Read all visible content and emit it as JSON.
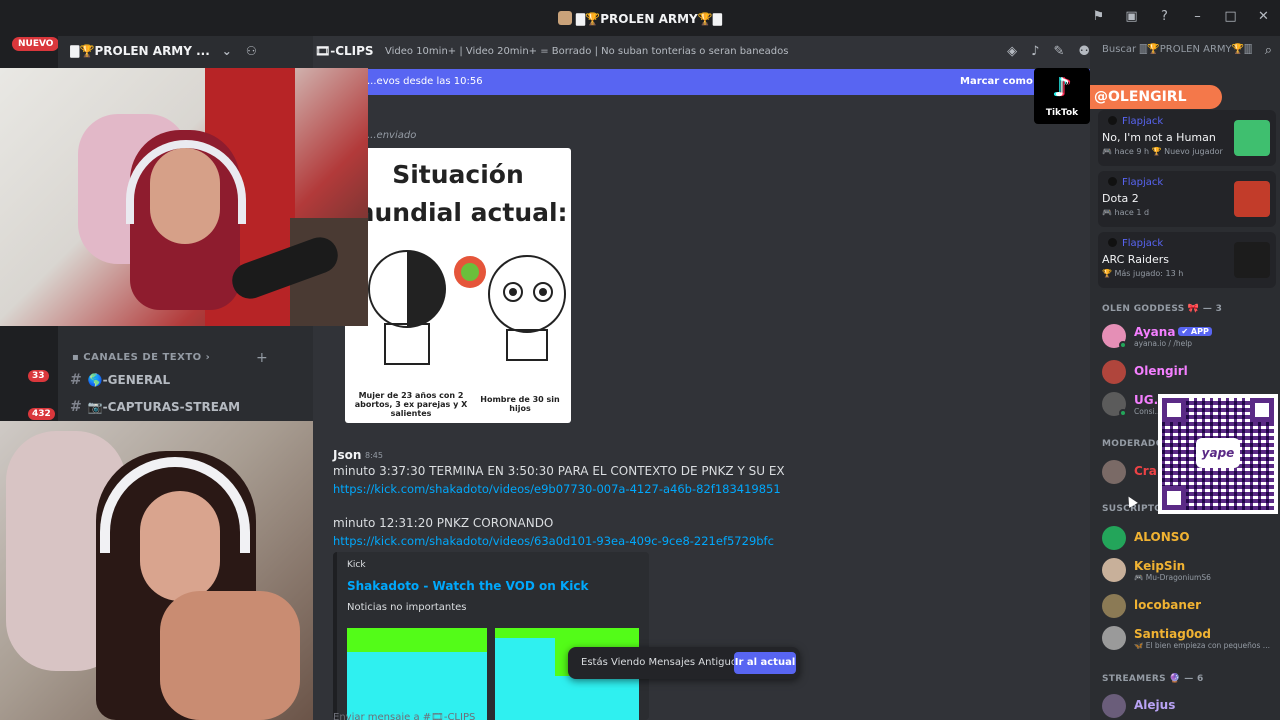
{
  "titlebar": {
    "title": "🀫🏆PROLEN ARMY🏆🀫"
  },
  "rail": {
    "new_badge": "NUEVO",
    "counts": [
      "33",
      "432"
    ]
  },
  "server": {
    "name": "🀫🏆PROLEN ARMY ..."
  },
  "sidebar": {
    "category": "CANALES DE TEXTO",
    "channels": [
      {
        "label": "🌎-GENERAL"
      },
      {
        "label": "📷-CAPTURAS-STREAM"
      }
    ]
  },
  "chat": {
    "channel_name": "🎞-CLIPS",
    "topic": "Video 10min+ | Video 20min+ = Borrado | No suban tonterias o seran baneados",
    "new_messages_bar": "...evos desde las 10:56",
    "mark_read": "Marcar como leí...",
    "sent_label": "...enviado",
    "meme": {
      "title1": "Situación",
      "title2": "mundial actual:",
      "caption_left": "Mujer de 23 años con 2 abortos, 3 ex parejas y X salientes",
      "caption_right": "Hombre de 30 sin hijos"
    },
    "message": {
      "author": "Json",
      "time": "8:45",
      "line1": "minuto 3:37:30  TERMINA EN  3:50:30  PARA EL CONTEXTO DE PNKZ Y SU EX",
      "link1": "https://kick.com/shakadoto/videos/e9b07730-007a-4127-a46b-82f183419851",
      "line2": "minuto 12:31:20 PNKZ CORONANDO",
      "link2": "https://kick.com/shakadoto/videos/63a0d101-93ea-409c-9ce8-221ef5729bfc"
    },
    "embed": {
      "provider": "Kick",
      "title": "Shakadoto - Watch the VOD on Kick",
      "description": "Noticias no importantes"
    },
    "old_messages_notice": "Estás Viendo Mensajes Antiguos",
    "jump_button": "Ir al actual",
    "composer_placeholder": "Enviar mensaje a #🎞-CLIPS"
  },
  "members": {
    "search_placeholder": "Buscar 🀫🏆PROLEN ARMY🏆🀫",
    "overlay_handle": "@OLENGIRL",
    "tiktok_label": "TikTok",
    "activities": [
      {
        "user": "Flapjack",
        "game": "No, I'm not a Human",
        "meta": "🎮 hace 9 h  🏆 Nuevo jugador",
        "art_color": "#3fbf6f"
      },
      {
        "user": "Flapjack",
        "game": "Dota 2",
        "meta": "🎮 hace 1 d",
        "art_color": "#c23c2a"
      },
      {
        "user": "Flapjack",
        "game": "ARC Raiders",
        "meta": "🏆 Más jugado: 13 h",
        "art_color": "#1c1c1c"
      }
    ],
    "section_goddess": "OLEN GODDESS 🎀 — 3",
    "goddess": [
      {
        "name": "Ayana",
        "tag": "✔ APP",
        "sub": "ayana.io / /help",
        "color": "#f47fff",
        "avatar": "#e58fb6"
      },
      {
        "name": "Olengirl",
        "tag": "",
        "sub": "",
        "color": "#f47fff",
        "avatar": "#b0453c"
      },
      {
        "name": "UG.E...",
        "tag": "",
        "sub": "Consi...",
        "color": "#f47fff",
        "avatar": "#5b5b5b"
      }
    ],
    "section_mods": "MODERADO...",
    "mods": [
      {
        "name": "Cra...",
        "color": "#ed4245",
        "avatar": "#7a6a66"
      }
    ],
    "section_subs": "SUSCRIPTO...",
    "subs": [
      {
        "name": "ALONSO",
        "sub": "",
        "avatar": "#23a55a"
      },
      {
        "name": "KeipSin",
        "sub": "🎮 Mu-DragoniumS6",
        "avatar": "#c8b09a"
      },
      {
        "name": "locobaner",
        "sub": "",
        "avatar": "#8b7a55"
      },
      {
        "name": "Santiag0od",
        "sub": "🦋 El bien empieza con pequeños ...",
        "avatar": "#9a9a9a"
      }
    ],
    "section_streamers": "STREAMERS 🔮 — 6",
    "streamers": [
      {
        "name": "Alejus",
        "avatar": "#6a5d7a"
      }
    ],
    "qr_brand": "yape"
  }
}
